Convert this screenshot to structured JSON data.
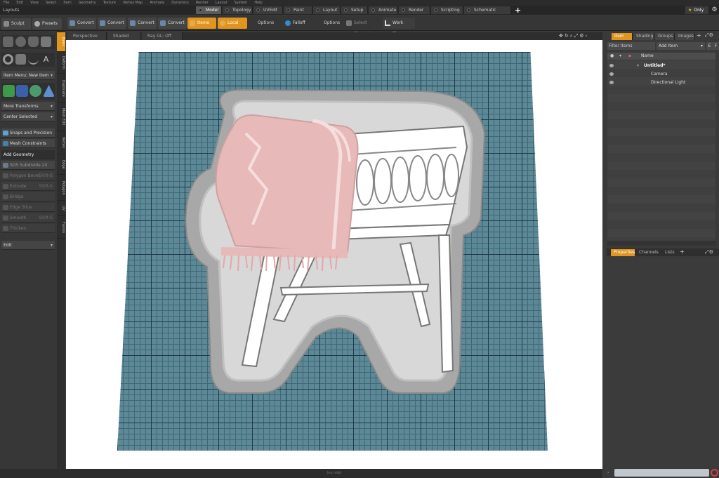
{
  "menu": [
    "File",
    "Edit",
    "View",
    "Select",
    "Item",
    "Geometry",
    "Texture",
    "Vertex Map",
    "Animate",
    "Dynamics",
    "Render",
    "Layout",
    "System",
    "Help"
  ],
  "layouts_label": "Layouts",
  "layout_tabs": [
    "Model",
    "Topology",
    "UVEdit",
    "Paint",
    "Layout",
    "Setup",
    "Animate",
    "Render",
    "Scripting",
    "Schematic Fusion"
  ],
  "only_label": "Only",
  "toolbar": {
    "sculpt": "Sculpt",
    "presets": "Presets",
    "convert1": "Convert",
    "convert2": "Convert",
    "convert3": "Convert",
    "convert4": "Convert",
    "items": "Items",
    "local": "Local",
    "options1": "Options",
    "falloff": "Falloff",
    "options2": "Options",
    "select_through": "Select Through",
    "work_plane": "Work Plane"
  },
  "viewport": {
    "perspective": "Perspective",
    "shaded": "Shaded",
    "raygl": "Ray GL: Off",
    "status": "(no info)"
  },
  "side_tabs": [
    "Basic",
    "Deform",
    "Duplicate",
    "Mesh Edit",
    "Vertex",
    "Edge",
    "Polygon",
    "UV",
    "Fusion"
  ],
  "left": {
    "item_menu": "Item Menu: New Item",
    "more_transforms": "More Transforms",
    "center_selected": "Center Selected",
    "snaps": "Snaps and Precision",
    "mesh_constraints": "Mesh Constraints",
    "add_geometry": "Add Geometry",
    "sds": "SDS Subdivide 2X",
    "polygon_bevel": "Polygon Bevel",
    "polygon_bevel_key": "Shift-B",
    "extrude": "Extrude",
    "extrude_key": "Shift-X",
    "bridge": "Bridge",
    "edge_slice": "Edge Slice",
    "smooth": "Smooth",
    "smooth_key": "Shift-S",
    "thicken": "Thicken",
    "edit": "Edit"
  },
  "right": {
    "tabs": [
      "Item ...",
      "Shading",
      "Groups",
      "Images"
    ],
    "filter": "Filter Items",
    "add_item": "Add Item",
    "e": "E",
    "f": "F",
    "name_col": "Name",
    "tree": [
      {
        "label": "Untitled*",
        "indent": 0
      },
      {
        "label": "Camera",
        "indent": 1
      },
      {
        "label": "Directional Light",
        "indent": 1
      }
    ],
    "props_tabs": [
      "Properties",
      "Channels",
      "Lists"
    ]
  },
  "colors": {
    "accent": "#e1951e",
    "grid": "#5d8896",
    "blanket": "#e8b9b9"
  }
}
